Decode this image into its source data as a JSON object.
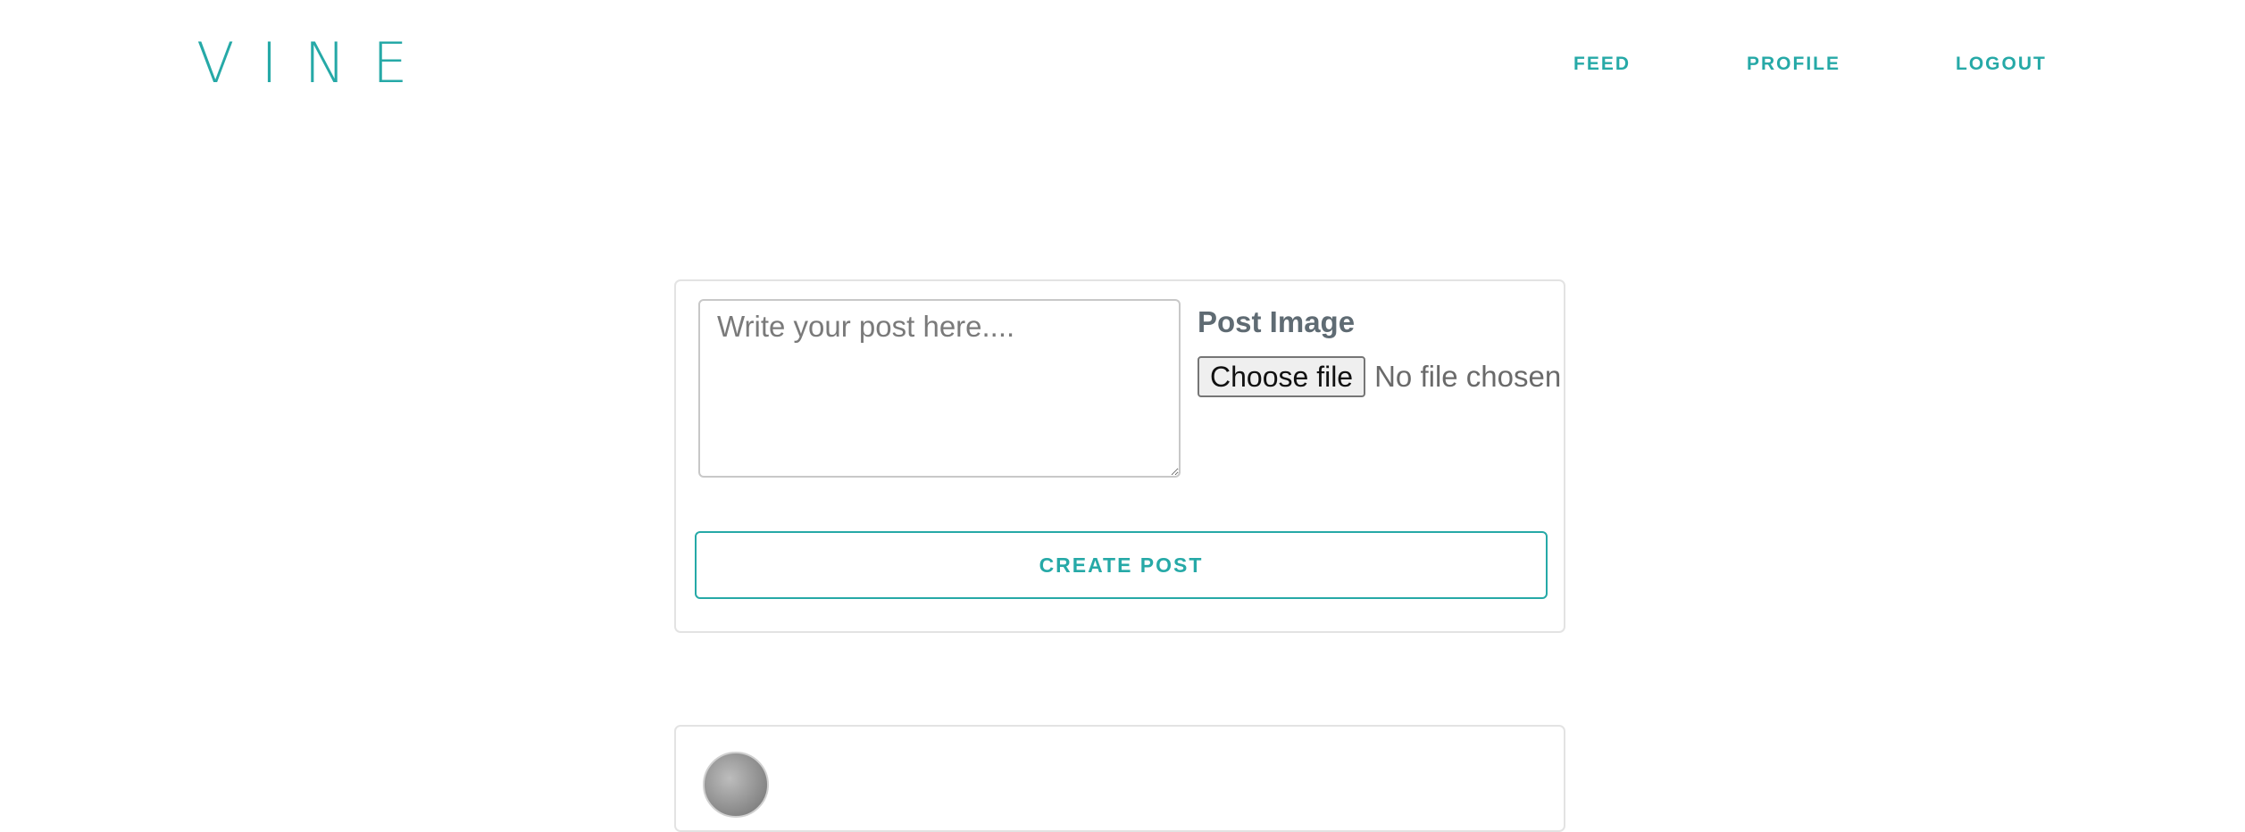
{
  "brand": {
    "name": "VINE",
    "color": "#26a9a7"
  },
  "nav": {
    "items": [
      {
        "label": "FEED"
      },
      {
        "label": "PROFILE"
      },
      {
        "label": "LOGOUT"
      }
    ]
  },
  "create_post": {
    "textarea_placeholder": "Write your post here....",
    "textarea_value": "",
    "image_label": "Post Image",
    "file_button_label": "Choose file",
    "file_status": "No file chosen",
    "submit_label": "CREATE POST"
  },
  "feed": {
    "posts": [
      {
        "avatar": "avatar-image"
      }
    ]
  }
}
